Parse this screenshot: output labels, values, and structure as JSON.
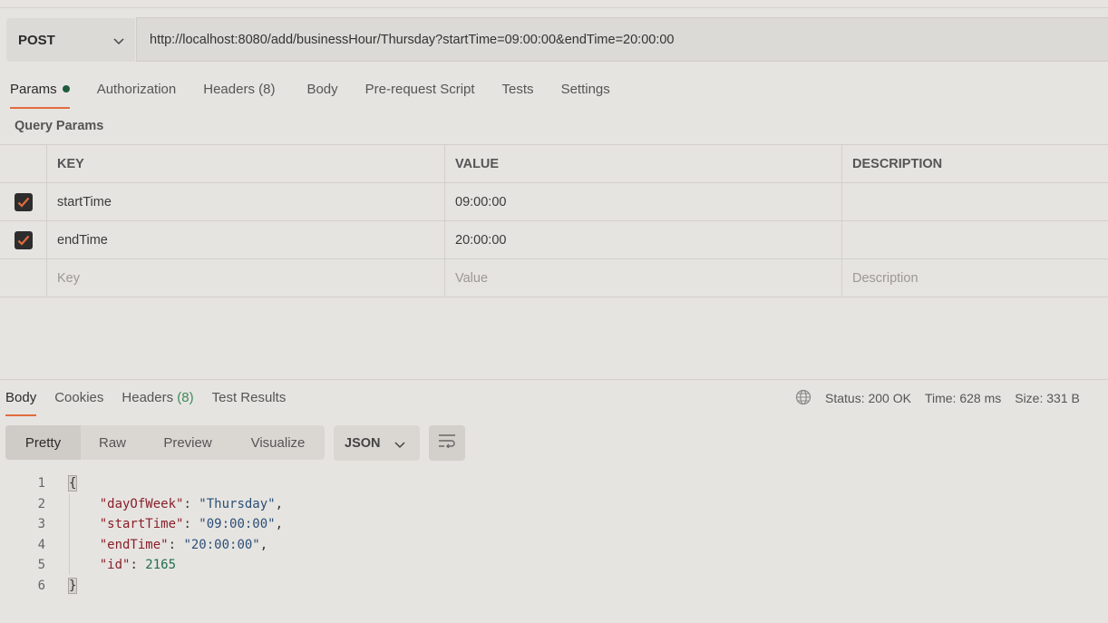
{
  "request": {
    "method": "POST",
    "url": "http://localhost:8080/add/businessHour/Thursday?startTime=09:00:00&endTime=20:00:00"
  },
  "request_tabs": [
    "Params",
    "Authorization",
    "Headers (8)",
    "Body",
    "Pre-request Script",
    "Tests",
    "Settings"
  ],
  "query_params": {
    "title": "Query Params",
    "headers": [
      "KEY",
      "VALUE",
      "DESCRIPTION"
    ],
    "rows": [
      {
        "key": "startTime",
        "value": "09:00:00",
        "description": "",
        "checked": true
      },
      {
        "key": "endTime",
        "value": "20:00:00",
        "description": "",
        "checked": true
      }
    ],
    "placeholder": {
      "key": "Key",
      "value": "Value",
      "description": "Description"
    }
  },
  "response_tabs": {
    "body": "Body",
    "cookies": "Cookies",
    "headers_label": "Headers",
    "headers_count": "(8)",
    "tests": "Test Results"
  },
  "status": {
    "status": "Status: 200 OK",
    "time": "Time: 628 ms",
    "size": "Size: 331 B"
  },
  "view_modes": [
    "Pretty",
    "Raw",
    "Preview",
    "Visualize"
  ],
  "format": "JSON",
  "response_body": {
    "line_numbers": [
      "1",
      "2",
      "3",
      "4",
      "5",
      "6"
    ],
    "open_brace": "{",
    "close_brace": "}",
    "fields": [
      {
        "key": "\"dayOfWeek\"",
        "value": "\"Thursday\"",
        "comma": ","
      },
      {
        "key": "\"startTime\"",
        "value": "\"09:00:00\"",
        "comma": ","
      },
      {
        "key": "\"endTime\"",
        "value": "\"20:00:00\"",
        "comma": ","
      },
      {
        "key": "\"id\"",
        "value": "2165",
        "comma": ""
      }
    ]
  },
  "colors": {
    "accent": "#e26b3e",
    "dot": "#1f5c3e",
    "json_key": "#8a1f2a",
    "json_string": "#2b4f78",
    "json_number": "#1e6e4f"
  }
}
